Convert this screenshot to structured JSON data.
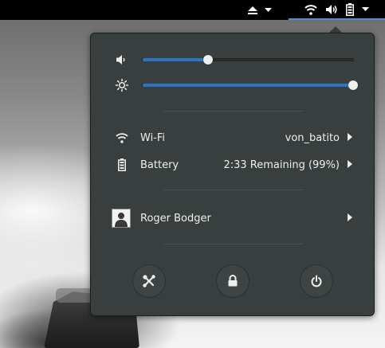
{
  "top_bar": {
    "icons": [
      "eject-icon",
      "chevron-down-icon",
      "wifi-icon",
      "volume-icon",
      "battery-icon",
      "chevron-down-icon"
    ]
  },
  "menu": {
    "volume": {
      "icon": "volume-icon",
      "level": 0.31
    },
    "brightness": {
      "icon": "brightness-icon",
      "level": 1.0
    },
    "wifi": {
      "icon": "wifi-icon",
      "label": "Wi-Fi",
      "value": "von_batito"
    },
    "battery": {
      "icon": "battery-icon",
      "label": "Battery",
      "value": "2:33 Remaining (99%)"
    },
    "user": {
      "icon": "avatar-icon",
      "name": "Roger Bodger"
    },
    "actions": [
      {
        "name": "settings",
        "icon": "settings-tools-icon"
      },
      {
        "name": "lock",
        "icon": "lock-icon"
      },
      {
        "name": "power",
        "icon": "power-icon"
      }
    ]
  },
  "colors": {
    "accent": "#2a76c6",
    "menu_bg": "#393f3f",
    "text": "#eeeeec"
  }
}
